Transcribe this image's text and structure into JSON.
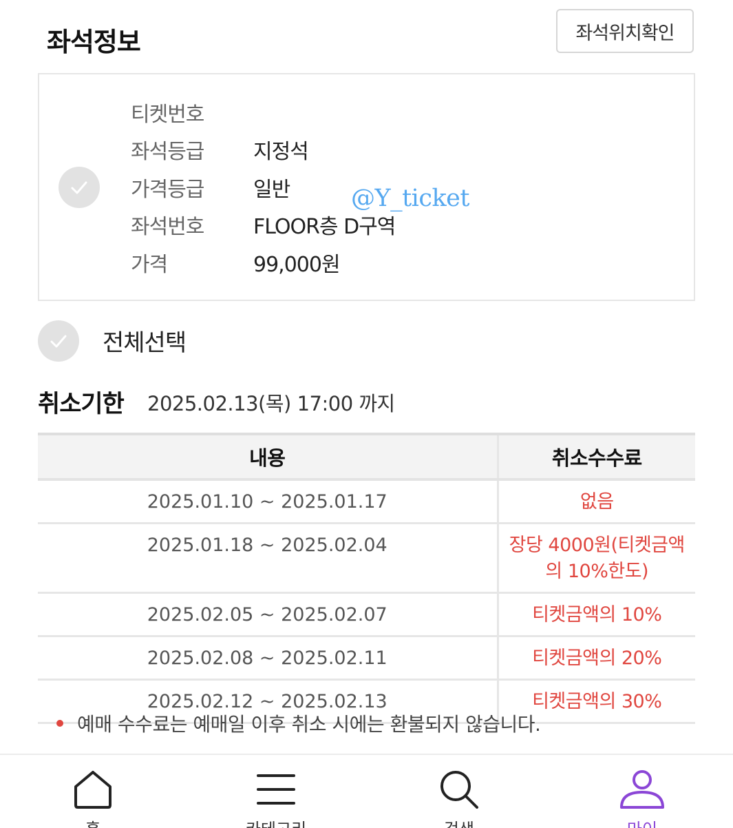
{
  "header": {
    "title": "좌석정보",
    "seat_location_button": "좌석위치확인"
  },
  "seat_info": {
    "rows": [
      {
        "label": "티켓번호",
        "value": ""
      },
      {
        "label": "좌석등급",
        "value": "지정석"
      },
      {
        "label": "가격등급",
        "value": "일반"
      },
      {
        "label": "좌석번호",
        "value": "FLOOR층 D구역"
      },
      {
        "label": "가격",
        "value": "99,000원"
      }
    ],
    "watermark": "@Y_ticket"
  },
  "select_all": {
    "label": "전체선택"
  },
  "cancel_deadline": {
    "title": "취소기한",
    "value": "2025.02.13(목) 17:00 까지"
  },
  "fee_table": {
    "headers": [
      "내용",
      "취소수수료"
    ],
    "rows": [
      {
        "period": "2025.01.10 ~ 2025.01.17",
        "fee": "없음"
      },
      {
        "period": "2025.01.18 ~ 2025.02.04",
        "fee": "장당 4000원(티켓금액의 10%한도)"
      },
      {
        "period": "2025.02.05 ~ 2025.02.07",
        "fee": "티켓금액의 10%"
      },
      {
        "period": "2025.02.08 ~ 2025.02.11",
        "fee": "티켓금액의 20%"
      },
      {
        "period": "2025.02.12 ~ 2025.02.13",
        "fee": "티켓금액의 30%"
      }
    ]
  },
  "notice": {
    "text": "예매 수수료는 예매일 이후 취소 시에는 환불되지 않습니다."
  },
  "bottom_nav": {
    "items": [
      {
        "label": "홈",
        "icon": "home-icon"
      },
      {
        "label": "카테고리",
        "icon": "menu-icon"
      },
      {
        "label": "검색",
        "icon": "search-icon"
      },
      {
        "label": "마이",
        "icon": "user-icon",
        "active": true
      }
    ]
  },
  "colors": {
    "accent": "#8b46d6",
    "fee_text": "#e0463f",
    "watermark": "#55a8f0",
    "check_circle": "#e2e2e2"
  }
}
